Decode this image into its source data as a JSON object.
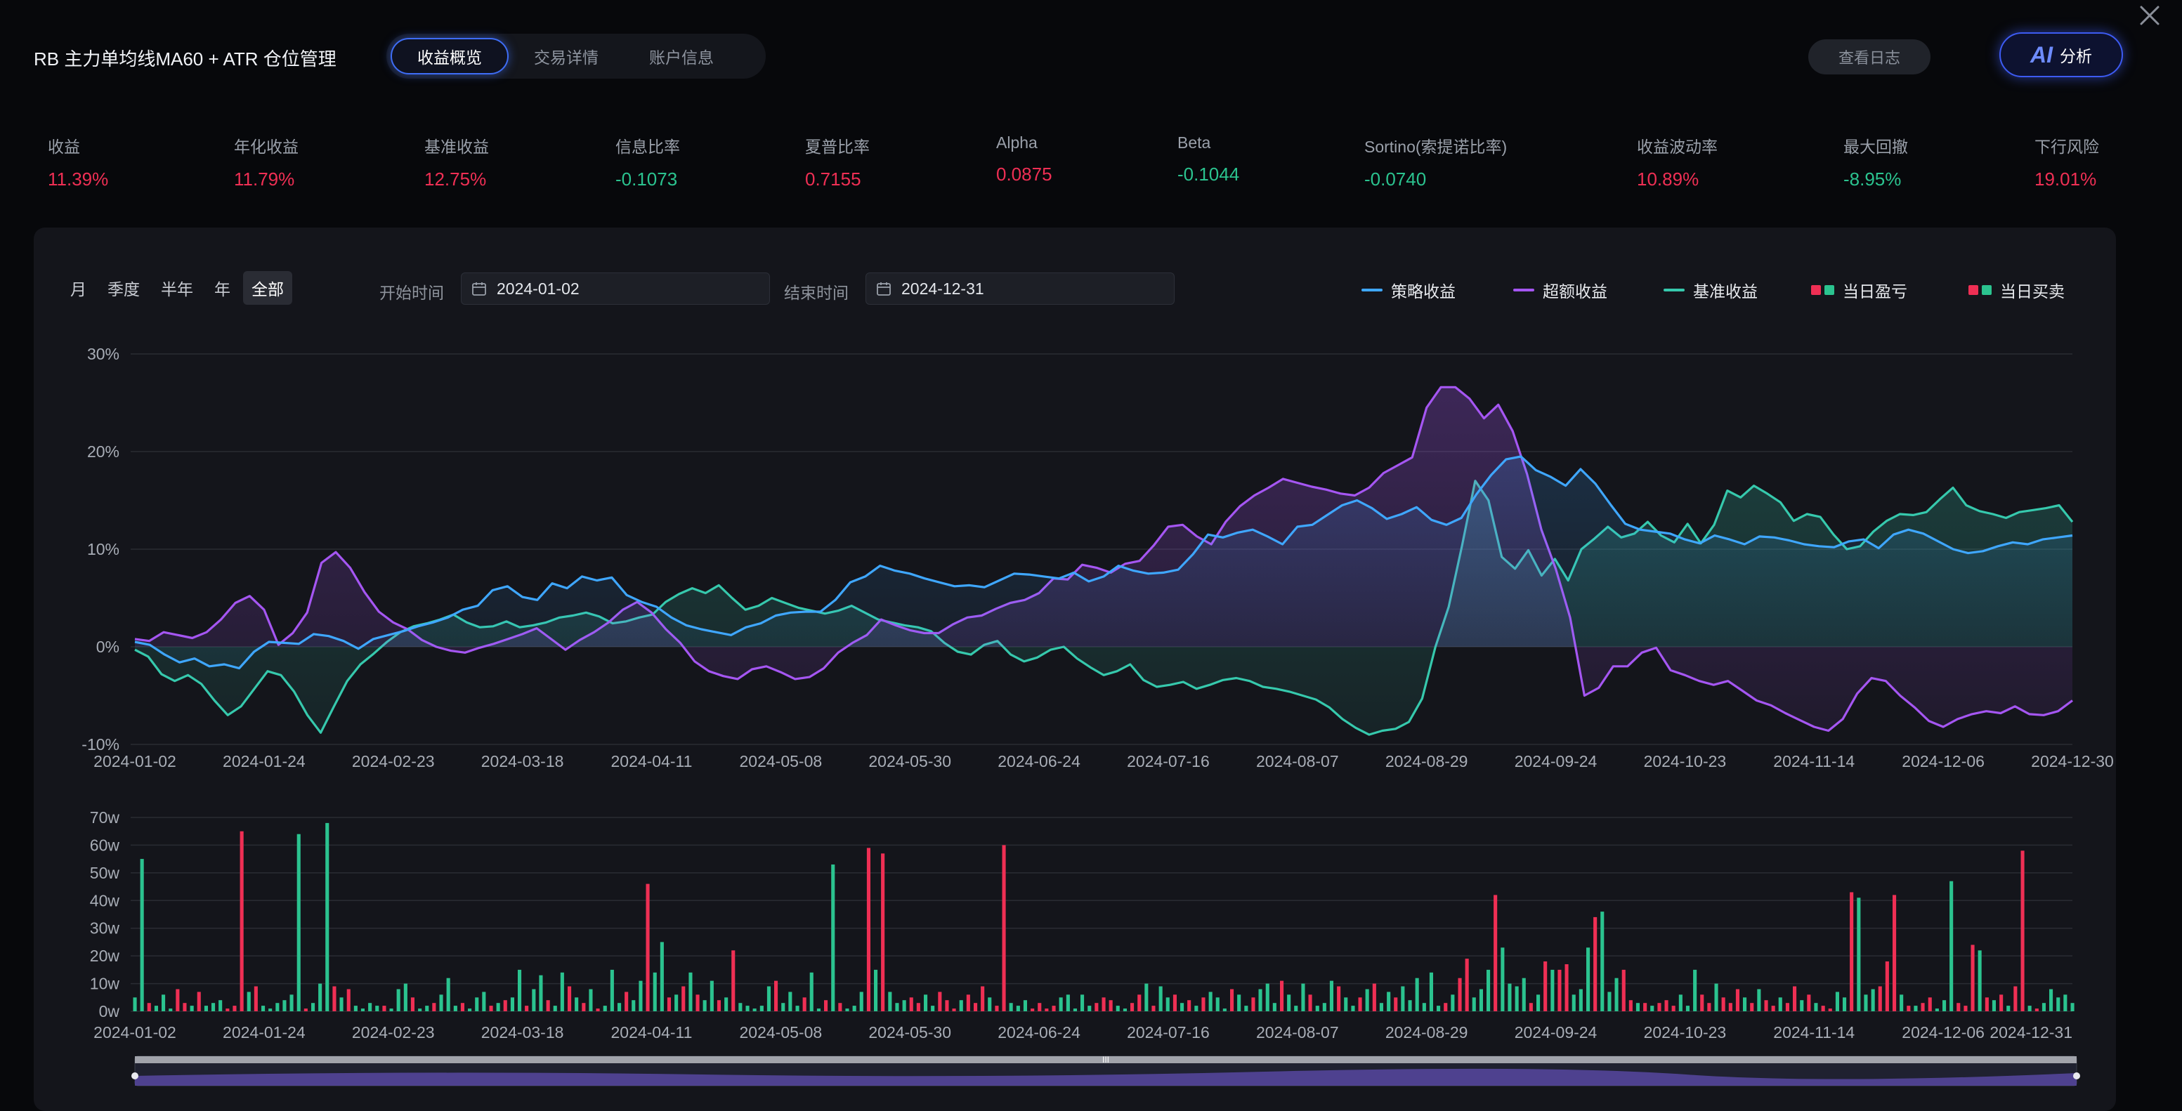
{
  "header": {
    "title": "RB 主力单均线MA60 + ATR 仓位管理",
    "tabs": [
      {
        "label": "收益概览",
        "active": true
      },
      {
        "label": "交易详情",
        "active": false
      },
      {
        "label": "账户信息",
        "active": false
      }
    ],
    "log_button": "查看日志",
    "ai_button": {
      "mark": "AI",
      "label": "分析"
    }
  },
  "metrics": [
    {
      "label": "收益",
      "value": "11.39%",
      "tone": "pos"
    },
    {
      "label": "年化收益",
      "value": "11.79%",
      "tone": "pos"
    },
    {
      "label": "基准收益",
      "value": "12.75%",
      "tone": "pos"
    },
    {
      "label": "信息比率",
      "value": "-0.1073",
      "tone": "neg"
    },
    {
      "label": "夏普比率",
      "value": "0.7155",
      "tone": "pos"
    },
    {
      "label": "Alpha",
      "value": "0.0875",
      "tone": "pos"
    },
    {
      "label": "Beta",
      "value": "-0.1044",
      "tone": "neg"
    },
    {
      "label": "Sortino(索提诺比率)",
      "value": "-0.0740",
      "tone": "neg"
    },
    {
      "label": "收益波动率",
      "value": "10.89%",
      "tone": "pos"
    },
    {
      "label": "最大回撤",
      "value": "-8.95%",
      "tone": "neg"
    },
    {
      "label": "下行风险",
      "value": "19.01%",
      "tone": "pos"
    }
  ],
  "controls": {
    "periods": [
      {
        "label": "月",
        "active": false
      },
      {
        "label": "季度",
        "active": false
      },
      {
        "label": "半年",
        "active": false
      },
      {
        "label": "年",
        "active": false
      },
      {
        "label": "全部",
        "active": true
      }
    ],
    "start_label": "开始时间",
    "start_date": "2024-01-02",
    "end_label": "结束时间",
    "end_date": "2024-12-31"
  },
  "legend": [
    {
      "label": "策略收益",
      "kind": "line",
      "color": "#3fa7ff"
    },
    {
      "label": "超额收益",
      "kind": "line",
      "color": "#a556f2"
    },
    {
      "label": "基准收益",
      "kind": "line",
      "color": "#36c9ad"
    },
    {
      "label": "当日盈亏",
      "kind": "boxes",
      "colors": [
        "#ef2f54",
        "#2bc38f"
      ]
    },
    {
      "label": "当日买卖",
      "kind": "boxes",
      "colors": [
        "#ef2f54",
        "#2bc38f"
      ]
    }
  ],
  "colors": {
    "strategy": "#3fa7ff",
    "excess": "#a556f2",
    "benchmark": "#36c9ad",
    "up": "#ef2f54",
    "down": "#2bc38f",
    "grid": "#2a2c33",
    "axis_text": "#a8adb6"
  },
  "chart_data": [
    {
      "type": "line",
      "ylim": [
        -10,
        30
      ],
      "y_ticks": [
        "30%",
        "20%",
        "10%",
        "0%",
        "-10%"
      ],
      "x_ticks": [
        "2024-01-02",
        "2024-01-24",
        "2024-02-23",
        "2024-03-18",
        "2024-04-11",
        "2024-05-08",
        "2024-05-30",
        "2024-06-24",
        "2024-07-16",
        "2024-08-07",
        "2024-08-29",
        "2024-09-24",
        "2024-10-23",
        "2024-11-14",
        "2024-12-06",
        "2024-12-30"
      ],
      "series": [
        {
          "name": "策略收益",
          "color": "#3fa7ff",
          "values": [
            0.5,
            0.2,
            -0.8,
            -1.6,
            -1.2,
            -2.0,
            -1.8,
            -2.2,
            -0.5,
            0.5,
            0.4,
            0.3,
            1.3,
            1.1,
            0.6,
            -0.2,
            0.8,
            1.2,
            1.6,
            2.1,
            2.5,
            3.0,
            3.8,
            4.2,
            5.8,
            6.2,
            5.1,
            4.8,
            6.5,
            6.0,
            7.2,
            6.8,
            7.1,
            5.3,
            4.6,
            4.1,
            3.0,
            2.2,
            1.8,
            1.5,
            1.2,
            2.0,
            2.4,
            3.2,
            3.5,
            3.6,
            3.6,
            4.8,
            6.6,
            7.2,
            8.3,
            7.8,
            7.5,
            7.0,
            6.6,
            6.2,
            6.3,
            6.1,
            6.8,
            7.5,
            7.4,
            7.2,
            7.0,
            7.6,
            6.7,
            7.2,
            8.3,
            7.8,
            7.5,
            7.6,
            7.9,
            9.5,
            11.5,
            11.2,
            11.7,
            12.0,
            11.3,
            10.5,
            12.3,
            12.5,
            13.5,
            14.5,
            15.0,
            14.2,
            13.1,
            13.6,
            14.3,
            13.0,
            12.5,
            13.2,
            15.6,
            17.6,
            19.2,
            19.5,
            18.1,
            17.4,
            16.5,
            18.2,
            16.7,
            14.6,
            12.6,
            12.0,
            11.8,
            11.6,
            11.0,
            10.6,
            11.4,
            11.0,
            10.5,
            11.3,
            11.2,
            10.9,
            10.5,
            10.3,
            10.2,
            10.8,
            11.0,
            10.1,
            11.5,
            12.0,
            11.6,
            10.8,
            10.0,
            9.6,
            9.8,
            10.3,
            10.7,
            10.5,
            11.0,
            11.2,
            11.4
          ]
        },
        {
          "name": "超额收益",
          "color": "#a556f2",
          "values": [
            0.8,
            0.6,
            1.5,
            1.2,
            0.9,
            1.5,
            2.8,
            4.5,
            5.2,
            3.8,
            0.2,
            1.4,
            3.5,
            8.6,
            9.7,
            8.1,
            5.6,
            3.6,
            2.5,
            1.8,
            0.7,
            0.0,
            -0.4,
            -0.6,
            -0.1,
            0.3,
            0.8,
            1.3,
            1.9,
            0.8,
            -0.3,
            0.7,
            1.5,
            2.5,
            3.8,
            4.6,
            3.5,
            1.8,
            0.4,
            -1.5,
            -2.5,
            -3.0,
            -3.3,
            -2.3,
            -2.0,
            -2.6,
            -3.3,
            -3.1,
            -2.2,
            -0.6,
            0.4,
            1.2,
            2.8,
            2.2,
            1.7,
            1.4,
            1.4,
            2.3,
            3.0,
            3.2,
            3.9,
            4.5,
            4.8,
            5.5,
            7.0,
            6.9,
            8.4,
            8.1,
            7.6,
            8.5,
            8.8,
            10.4,
            12.3,
            12.5,
            11.3,
            10.5,
            12.8,
            14.4,
            15.5,
            16.3,
            17.2,
            16.8,
            16.4,
            16.1,
            15.7,
            15.5,
            16.3,
            17.8,
            18.6,
            19.4,
            24.5,
            26.6,
            26.6,
            25.4,
            23.4,
            24.8,
            22.1,
            17.7,
            12.0,
            8.0,
            3.0,
            -5.0,
            -4.2,
            -2.0,
            -2.0,
            -0.6,
            -0.1,
            -2.4,
            -2.9,
            -3.5,
            -3.9,
            -3.5,
            -4.5,
            -5.5,
            -6.0,
            -6.8,
            -7.5,
            -8.2,
            -8.6,
            -7.4,
            -4.8,
            -3.2,
            -3.5,
            -5.0,
            -6.2,
            -7.6,
            -8.2,
            -7.4,
            -6.9,
            -6.6,
            -6.8,
            -6.1,
            -6.9,
            -7.0,
            -6.6,
            -5.5
          ]
        },
        {
          "name": "基准收益",
          "color": "#36c9ad",
          "values": [
            -0.3,
            -1.0,
            -2.8,
            -3.5,
            -2.9,
            -3.8,
            -5.5,
            -7.0,
            -6.1,
            -4.3,
            -2.5,
            -2.9,
            -4.6,
            -7.0,
            -8.8,
            -6.1,
            -3.5,
            -1.8,
            -0.7,
            0.5,
            1.5,
            2.1,
            2.4,
            2.8,
            3.3,
            2.5,
            2.0,
            2.1,
            2.6,
            2.0,
            2.2,
            2.5,
            3.0,
            3.2,
            3.5,
            3.1,
            2.4,
            2.6,
            3.0,
            3.3,
            4.6,
            5.4,
            6.0,
            5.5,
            6.3,
            5.0,
            3.8,
            4.2,
            5.0,
            4.5,
            4.0,
            3.7,
            3.4,
            3.7,
            4.2,
            3.5,
            2.8,
            2.5,
            2.2,
            2.0,
            1.6,
            0.4,
            -0.5,
            -0.8,
            0.2,
            0.6,
            -0.8,
            -1.5,
            -1.1,
            -0.3,
            0.0,
            -1.2,
            -2.1,
            -2.9,
            -2.5,
            -1.8,
            -3.4,
            -4.1,
            -3.9,
            -3.6,
            -4.3,
            -3.9,
            -3.4,
            -3.2,
            -3.5,
            -4.1,
            -4.3,
            -4.6,
            -5.0,
            -5.4,
            -6.2,
            -7.4,
            -8.3,
            -9.0,
            -8.6,
            -8.4,
            -7.7,
            -5.3,
            0.0,
            4.1,
            10.3,
            17.0,
            15.0,
            9.2,
            8.0,
            9.9,
            7.3,
            9.0,
            6.8,
            10.0,
            11.1,
            12.3,
            11.2,
            11.6,
            12.8,
            11.4,
            10.7,
            12.6,
            10.6,
            12.5,
            16.0,
            15.3,
            16.5,
            15.7,
            14.8,
            12.9,
            13.6,
            13.3,
            11.5,
            10.0,
            10.3,
            11.8,
            12.9,
            13.6,
            13.5,
            13.8,
            15.1,
            16.3,
            14.5,
            13.9,
            13.6,
            13.2,
            13.8,
            14.0,
            14.2,
            14.5,
            12.8
          ]
        }
      ]
    },
    {
      "type": "bar",
      "ylim": [
        0,
        70
      ],
      "unit": "w",
      "y_ticks": [
        "70w",
        "60w",
        "50w",
        "40w",
        "30w",
        "20w",
        "10w",
        "0w"
      ],
      "x_ticks": [
        "2024-01-02",
        "2024-01-24",
        "2024-02-23",
        "2024-03-18",
        "2024-04-11",
        "2024-05-08",
        "2024-05-30",
        "2024-06-24",
        "2024-07-16",
        "2024-08-07",
        "2024-08-29",
        "2024-09-24",
        "2024-10-23",
        "2024-11-14",
        "2024-12-06",
        "2024-12-31"
      ],
      "note_sign": "+ = 红(盈) , - = 绿(亏)",
      "values": [
        5,
        55,
        -3,
        2,
        6,
        1,
        -8,
        -3,
        2,
        -7,
        2,
        3,
        4,
        -1,
        -2,
        -65,
        7,
        -9,
        2,
        1,
        3,
        4,
        6,
        64,
        -1,
        3,
        10,
        68,
        -9,
        5,
        -8,
        2,
        1,
        3,
        2,
        -2,
        1,
        8,
        10,
        -5,
        1,
        2,
        -3,
        6,
        12,
        2,
        -3,
        1,
        5,
        7,
        -2,
        3,
        -4,
        5,
        15,
        -2,
        8,
        13,
        -4,
        2,
        14,
        -9,
        5,
        -3,
        8,
        -1,
        2,
        15,
        3,
        -7,
        4,
        11,
        -46,
        14,
        25,
        -5,
        6,
        -9,
        14,
        -6,
        4,
        11,
        -4,
        5,
        -22,
        3,
        2,
        1,
        2,
        9,
        -11,
        3,
        7,
        2,
        -5,
        14,
        1,
        -4,
        53,
        -3,
        1,
        2,
        7,
        -59,
        15,
        -57,
        7,
        3,
        4,
        -5,
        -3,
        6,
        2,
        -7,
        -4,
        -1,
        4,
        -6,
        -3,
        -9,
        5,
        -2,
        -60,
        3,
        2,
        4,
        -1,
        -3,
        -1,
        -2,
        5,
        6,
        1,
        6,
        2,
        -3,
        -5,
        -4,
        2,
        1,
        -3,
        -6,
        10,
        -2,
        9,
        5,
        -6,
        3,
        -4,
        2,
        -5,
        7,
        5,
        1,
        -8,
        6,
        2,
        -5,
        8,
        10,
        3,
        -11,
        6,
        2,
        10,
        -6,
        2,
        3,
        11,
        -9,
        5,
        2,
        -5,
        8,
        -10,
        3,
        7,
        -5,
        9,
        4,
        12,
        3,
        14,
        2,
        -3,
        6,
        -12,
        -19,
        5,
        8,
        15,
        -42,
        23,
        10,
        9,
        12,
        -3,
        6,
        -18,
        15,
        -15,
        -17,
        6,
        8,
        23,
        -34,
        36,
        7,
        12,
        -15,
        -4,
        3,
        -3,
        2,
        -3,
        -4,
        -2,
        6,
        2,
        15,
        -6,
        -3,
        10,
        -5,
        -3,
        -8,
        5,
        -3,
        8,
        -4,
        -2,
        5,
        -3,
        -9,
        4,
        -6,
        3,
        -2,
        -1,
        7,
        5,
        -43,
        41,
        6,
        8,
        -9,
        -18,
        -42,
        6,
        -2,
        2,
        -3,
        -5,
        1,
        4,
        47,
        -3,
        -2,
        -24,
        22,
        -5,
        4,
        -6,
        2,
        -9,
        -58,
        2,
        -1,
        3,
        8,
        5,
        6,
        3
      ]
    }
  ]
}
